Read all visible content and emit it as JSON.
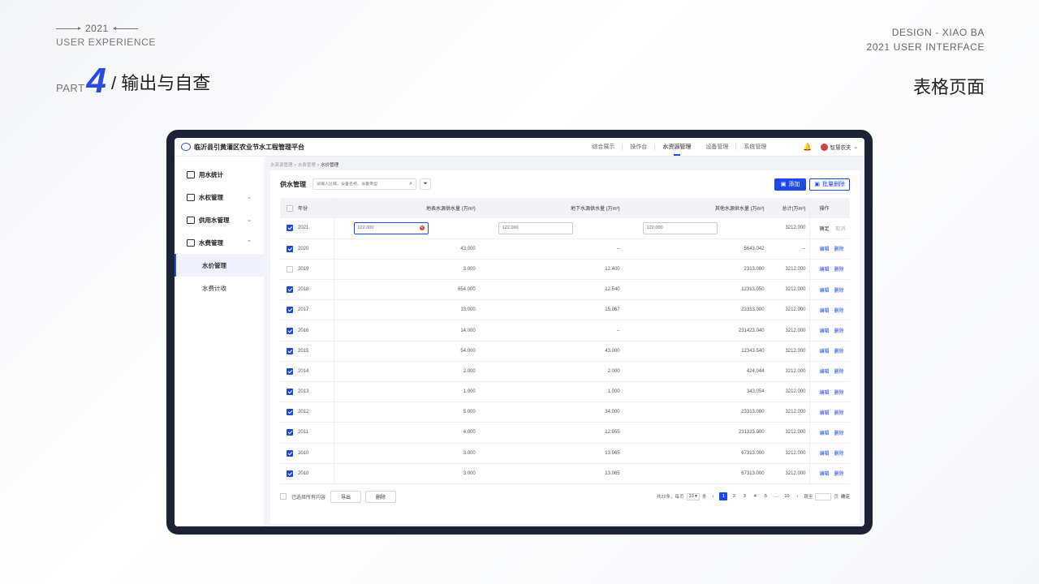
{
  "slide": {
    "year": "2021",
    "ux": "USER EXPERIENCE",
    "design_line1": "DESIGN - XIAO BA",
    "design_line2": "2021 USER INTERFACE",
    "part_label": "PART",
    "part_num": "4",
    "part_title": "/ 输出与自查",
    "title_right": "表格页面"
  },
  "app": {
    "title": "临沂县引黄灌区农业节水工程管理平台",
    "nav": [
      "综合展示",
      "操作台",
      "水资源管理",
      "设备管理",
      "系统管理"
    ],
    "nav_active_index": 2,
    "user": "智慧农夫"
  },
  "sidebar": {
    "items": [
      {
        "label": "用水统计",
        "icon": "chart-icon",
        "arrow": ""
      },
      {
        "label": "水权管理",
        "icon": "doc-icon",
        "arrow": "⌄"
      },
      {
        "label": "供用水管理",
        "icon": "list-icon",
        "arrow": "⌄"
      },
      {
        "label": "水费管理",
        "icon": "money-icon",
        "arrow": "⌃"
      }
    ],
    "subs": [
      {
        "label": "水价管理",
        "active": true
      },
      {
        "label": "水费计收",
        "active": false
      }
    ]
  },
  "breadcrumb": [
    "水资源管理",
    "水费管理",
    "水价管理"
  ],
  "toolbar": {
    "title": "供水管理",
    "search_placeholder": "请输入区域、设备名称、设备类型",
    "add_label": "添加",
    "batch_delete_label": "批量删除"
  },
  "table": {
    "headers": [
      "年份",
      "地表水源供水量 (万m³)",
      "地下水源供水量 (万m³)",
      "其他水源供水量 (万m³)",
      "总计(万m³)",
      "操作"
    ],
    "edit_row": {
      "year": "2021",
      "v1": "122.000",
      "v2": "122.000",
      "v3": "122.000",
      "total": "3212.000",
      "confirm": "确定",
      "cancel": "取消"
    },
    "rows": [
      {
        "year": "2020",
        "checked": true,
        "v1": "43.000",
        "v2": "--",
        "v3": "5643.042",
        "total": "--"
      },
      {
        "year": "2019",
        "checked": false,
        "v1": "3.000",
        "v2": "12.400",
        "v3": "2313.000",
        "total": "3212.000"
      },
      {
        "year": "2018",
        "checked": true,
        "v1": "654.000",
        "v2": "12.540",
        "v3": "12313.050",
        "total": "3212.000"
      },
      {
        "year": "2017",
        "checked": true,
        "v1": "13.000",
        "v2": "15.067",
        "v3": "23313.000",
        "total": "3212.000"
      },
      {
        "year": "2016",
        "checked": true,
        "v1": "14.000",
        "v2": "--",
        "v3": "231423.040",
        "total": "3212.000"
      },
      {
        "year": "2015",
        "checked": true,
        "v1": "54.000",
        "v2": "43.000",
        "v3": "12343.540",
        "total": "3212.000"
      },
      {
        "year": "2014",
        "checked": true,
        "v1": "2.000",
        "v2": "2.000",
        "v3": "424.044",
        "total": "3212.000"
      },
      {
        "year": "2013",
        "checked": true,
        "v1": "1.000",
        "v2": "1.000",
        "v3": "343.054",
        "total": "3212.000"
      },
      {
        "year": "2012",
        "checked": true,
        "v1": "5.000",
        "v2": "34.000",
        "v3": "23313.000",
        "total": "3212.000"
      },
      {
        "year": "2011",
        "checked": true,
        "v1": "4.000",
        "v2": "12.055",
        "v3": "231323.000",
        "total": "3212.000"
      },
      {
        "year": "2010",
        "checked": true,
        "v1": "3.000",
        "v2": "13.065",
        "v3": "67313.000",
        "total": "3212.000"
      },
      {
        "year": "2010",
        "checked": true,
        "v1": "3.000",
        "v2": "13.065",
        "v3": "67313.000",
        "total": "3212.000"
      }
    ],
    "edit_label": "编辑",
    "delete_label": "删除"
  },
  "footer": {
    "select_all": "已选择所有内容",
    "export": "导出",
    "delete": "删除"
  },
  "pager": {
    "total": "共22条，每页",
    "size": "10",
    "unit": "条",
    "pages": [
      "1",
      "2",
      "3",
      "4",
      "5",
      "...",
      "10"
    ],
    "current": "1",
    "jump_label": "跳至",
    "page_unit": "页",
    "go": "确定"
  },
  "colors": {
    "accent": "#1d49e6",
    "frame": "#1a2233"
  }
}
